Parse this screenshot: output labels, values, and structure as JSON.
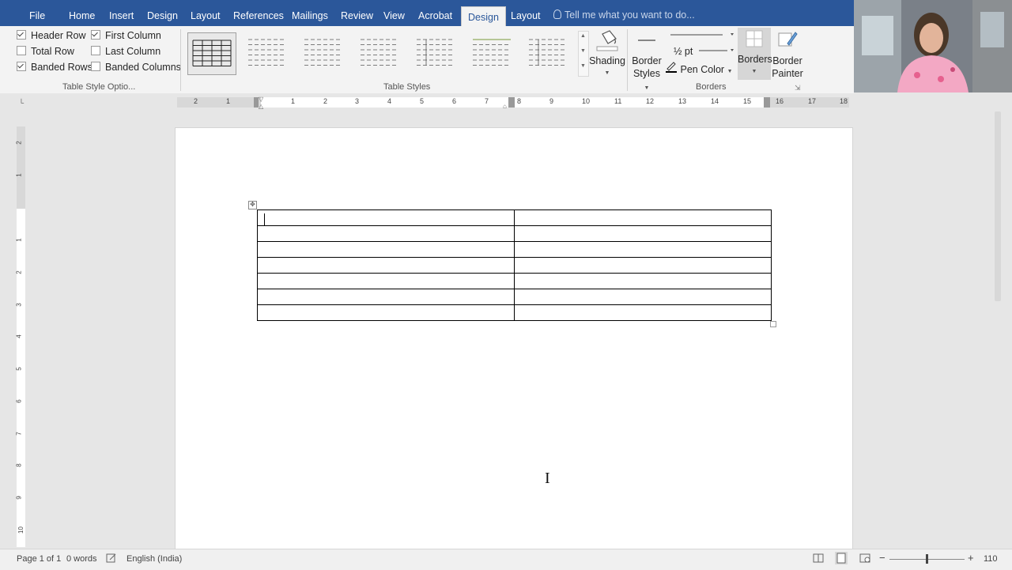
{
  "tabs": [
    {
      "label": "File",
      "active": false
    },
    {
      "label": "Home",
      "active": false
    },
    {
      "label": "Insert",
      "active": false
    },
    {
      "label": "Design",
      "active": false
    },
    {
      "label": "Layout",
      "active": false
    },
    {
      "label": "References",
      "active": false
    },
    {
      "label": "Mailings",
      "active": false
    },
    {
      "label": "Review",
      "active": false
    },
    {
      "label": "View",
      "active": false
    },
    {
      "label": "Acrobat",
      "active": false
    },
    {
      "label": "Design",
      "active": true
    },
    {
      "label": "Layout",
      "active": false
    }
  ],
  "tellme": "Tell me what you want to do...",
  "table_style_options": {
    "group_label": "Table Style Optio...",
    "header_row": {
      "label": "Header Row",
      "checked": true
    },
    "first_column": {
      "label": "First Column",
      "checked": true
    },
    "total_row": {
      "label": "Total Row",
      "checked": false
    },
    "last_column": {
      "label": "Last Column",
      "checked": false
    },
    "banded_rows": {
      "label": "Banded Rows",
      "checked": true
    },
    "banded_columns": {
      "label": "Banded Columns",
      "checked": false
    }
  },
  "table_styles": {
    "group_label": "Table Styles"
  },
  "shading": {
    "label": "Shading"
  },
  "borders_group": {
    "group_label": "Borders",
    "border_styles_1": "Border",
    "border_styles_2": "Styles",
    "pen_weight": "½ pt",
    "pen_color": "Pen Color",
    "borders": "Borders",
    "painter_1": "Border",
    "painter_2": "Painter"
  },
  "ruler_numbers": [
    "2",
    "1",
    "1",
    "2",
    "3",
    "4",
    "5",
    "6",
    "7",
    "8",
    "9",
    "10",
    "11",
    "12",
    "13",
    "14",
    "15",
    "16",
    "17",
    "18"
  ],
  "vruler_numbers": [
    "2",
    "1",
    "1",
    "2",
    "3",
    "4",
    "5",
    "6",
    "7",
    "8",
    "9",
    "10"
  ],
  "document": {
    "rows": 7,
    "cols": 2
  },
  "status": {
    "page": "Page 1 of 1",
    "words": "0 words",
    "language": "English (India)",
    "zoom": "110"
  },
  "colors": {
    "tab_bar": "#2b579a",
    "ribbon": "#f3f3f3"
  }
}
